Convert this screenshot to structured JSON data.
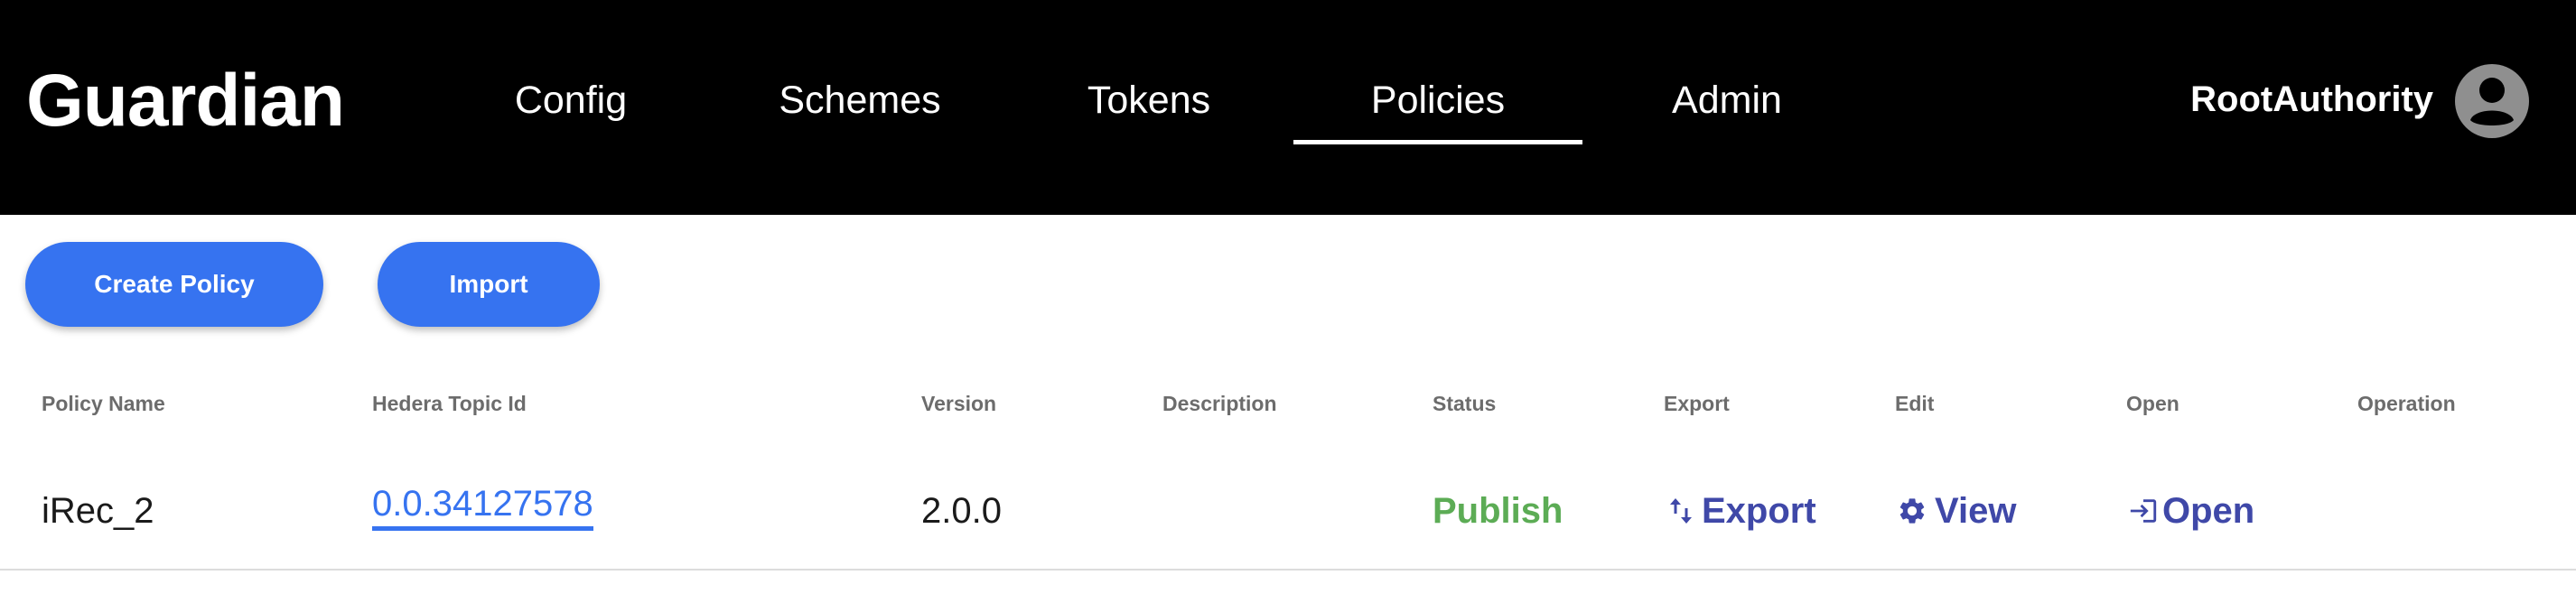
{
  "app": {
    "brand": "Guardian",
    "user": "RootAuthority"
  },
  "nav": {
    "tabs": [
      {
        "label": "Config"
      },
      {
        "label": "Schemes"
      },
      {
        "label": "Tokens"
      },
      {
        "label": "Policies",
        "active": true
      },
      {
        "label": "Admin"
      }
    ]
  },
  "actions": {
    "create_label": "Create Policy",
    "import_label": "Import"
  },
  "table": {
    "columns": [
      "Policy Name",
      "Hedera Topic Id",
      "Version",
      "Description",
      "Status",
      "Export",
      "Edit",
      "Open",
      "Operation"
    ],
    "rows": [
      {
        "name": "iRec_2",
        "topic_id": "0.0.34127578",
        "version": "2.0.0",
        "description": "",
        "status": "Publish",
        "export_label": "Export",
        "edit_label": "View",
        "open_label": "Open",
        "operation": ""
      }
    ]
  },
  "colors": {
    "header_bg": "#000000",
    "primary": "#3673f0",
    "status_publish": "#5cac55",
    "action_link": "#3f48a8"
  },
  "icons": {
    "export": "swap-vert-icon",
    "edit": "gear-icon",
    "open": "login-icon",
    "avatar": "account-circle-icon"
  }
}
